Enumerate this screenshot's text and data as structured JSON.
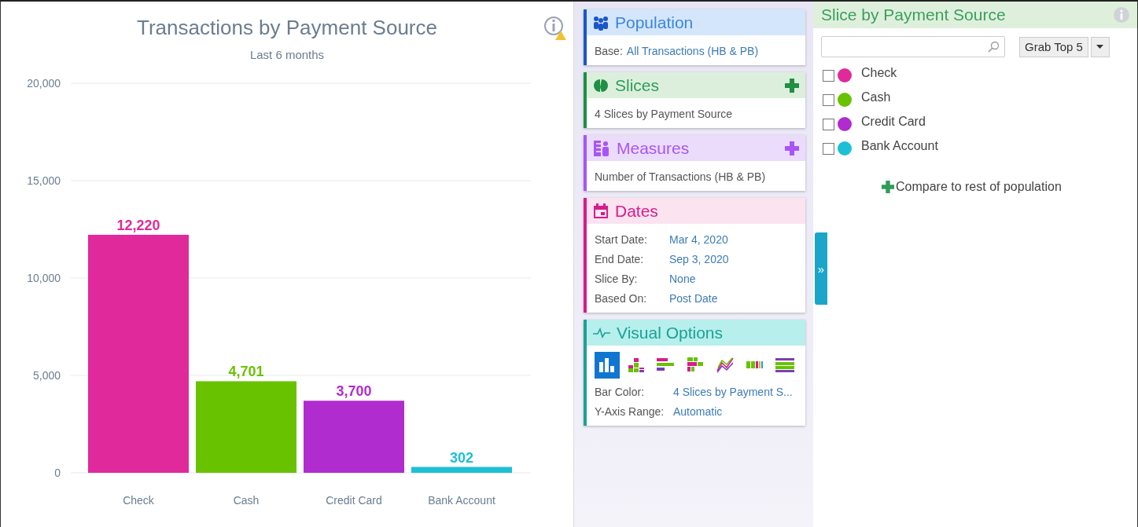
{
  "chart_panel": {
    "title": "Transactions by Payment Source",
    "subtitle": "Last 6 months",
    "chart_data": {
      "type": "bar",
      "categories": [
        "Check",
        "Cash",
        "Credit Card",
        "Bank Account"
      ],
      "grid": true,
      "series": [
        {
          "colors": [
            "#e0299b",
            "#69c200",
            "#b02ccf",
            "#1cbfd6"
          ],
          "values": [
            12220,
            4701,
            3700,
            302
          ]
        }
      ],
      "ylim": [
        0,
        20000
      ],
      "yticks": [
        {
          "value": 0,
          "label": "0"
        },
        {
          "value": 5000,
          "label": "5,000"
        },
        {
          "value": 10000,
          "label": "10,000"
        },
        {
          "value": 15000,
          "label": "15,000"
        },
        {
          "value": 20000,
          "label": "20,000"
        }
      ],
      "value_labels": [
        "12,220",
        "4,701",
        "3,700",
        "302"
      ]
    }
  },
  "cards": [
    {
      "kind": "population",
      "title": "Population",
      "addable": false,
      "rows": [
        {
          "label": "Base:",
          "value": "All Transactions (HB & PB)"
        }
      ]
    },
    {
      "kind": "slices",
      "title": "Slices",
      "addable": true,
      "rows": [
        {
          "label": "4 Slices by Payment Source"
        }
      ]
    },
    {
      "kind": "measures",
      "title": "Measures",
      "addable": true,
      "rows": [
        {
          "label": "Number of Transactions (HB & PB)"
        }
      ]
    },
    {
      "kind": "dates",
      "title": "Dates",
      "addable": false,
      "rows": [
        {
          "label": "Start Date:",
          "value": "Mar 4, 2020"
        },
        {
          "label": "End Date:",
          "value": "Sep 3, 2020"
        },
        {
          "label": "Slice By:",
          "value": "None"
        },
        {
          "label": "Based On:",
          "value": "Post Date"
        }
      ]
    },
    {
      "kind": "visual",
      "title": "Visual Options",
      "addable": false,
      "chart_types": [
        {
          "kind": "bar",
          "selected": true
        },
        {
          "kind": "stacked",
          "selected": false
        },
        {
          "kind": "hbar",
          "selected": false
        },
        {
          "kind": "hstacked",
          "selected": false
        },
        {
          "kind": "line",
          "selected": false
        },
        {
          "kind": "heatmap",
          "selected": false
        },
        {
          "kind": "rows",
          "selected": false
        }
      ],
      "rows": [
        {
          "label": "Bar Color:",
          "value": "4 Slices by Payment S..."
        },
        {
          "label": "Y-Axis Range:",
          "value": "Automatic"
        }
      ]
    }
  ],
  "expand_tab": "»",
  "slice_panel": {
    "title": "Slice by Payment Source",
    "grab_button": "Grab Top 5",
    "items": [
      {
        "label": "Check",
        "color": "#e0299b",
        "checked": false
      },
      {
        "label": "Cash",
        "color": "#69c200",
        "checked": false
      },
      {
        "label": "Credit Card",
        "color": "#b02ccf",
        "checked": false
      },
      {
        "label": "Bank Account",
        "color": "#1cbfd6",
        "checked": false
      }
    ],
    "compare_link": "Compare to rest of population"
  }
}
